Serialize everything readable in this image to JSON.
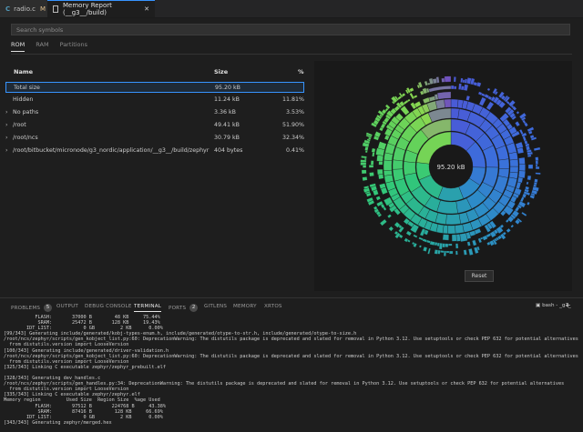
{
  "tabs": [
    {
      "icon": "C",
      "label": "radio.c",
      "status": "M"
    },
    {
      "label": "Memory Report (__g3__/build)",
      "close": "✕"
    }
  ],
  "search": {
    "placeholder": "Search symbols"
  },
  "subtabs": [
    "ROM",
    "RAM",
    "Partitions"
  ],
  "table": {
    "headers": {
      "name": "Name",
      "size": "Size",
      "percent": "%"
    },
    "rows": [
      {
        "name": "Total size",
        "size": "95.20 kB",
        "percent": "",
        "expandable": false,
        "selected": true
      },
      {
        "name": "Hidden",
        "size": "11.24 kB",
        "percent": "11.81%",
        "expandable": false
      },
      {
        "name": "No paths",
        "size": "3.36 kB",
        "percent": "3.53%",
        "expandable": true
      },
      {
        "name": "/root",
        "size": "49.41 kB",
        "percent": "51.90%",
        "expandable": true
      },
      {
        "name": "/root/ncs",
        "size": "30.79 kB",
        "percent": "32.34%",
        "expandable": true
      },
      {
        "name": "/root/bitbucket/micronode/g3_nordic/application/__g3__/build/zephyr",
        "size": "404 bytes",
        "percent": "0.41%",
        "expandable": true
      }
    ]
  },
  "chart": {
    "center_label": "95.20 kB",
    "reset_label": "Reset"
  },
  "panel": {
    "tabs": [
      {
        "label": "PROBLEMS",
        "badge": "5"
      },
      {
        "label": "OUTPUT"
      },
      {
        "label": "DEBUG CONSOLE"
      },
      {
        "label": "TERMINAL",
        "active": true
      },
      {
        "label": "PORTS",
        "badge": "2"
      },
      {
        "label": "GITLENS"
      },
      {
        "label": "MEMORY"
      },
      {
        "label": "XRTOS"
      }
    ],
    "terminal_label": "bash - _g1_",
    "plus": "+"
  },
  "terminal_lines": [
    "           FLASH:       37000 B        48 KB     75.44%",
    "            SRAM:       25472 B       128 KB     19.43%",
    "        IDT_LIST:           0 GB         2 KB      0.00%",
    "[99/343] Generating include/generated/kobj-types-enum.h, include/generated/otype-to-str.h, include/generated/otype-to-size.h",
    "/root/ncs/zephyr/scripts/gen_kobject_list.py:60: DeprecationWarning: The distutils package is deprecated and slated for removal in Python 3.12. Use setuptools or check PEP 632 for potential alternatives",
    "  from distutils.version import LooseVersion",
    "[100/343] Generating include/generated/driver-validation.h",
    "/root/ncs/zephyr/scripts/gen_kobject_list.py:60: DeprecationWarning: The distutils package is deprecated and slated for removal in Python 3.12. Use setuptools or check PEP 632 for potential alternatives",
    "  from distutils.version import LooseVersion",
    "[325/343] Linking C executable zephyr/zephyr_prebuilt.elf",
    "",
    "[328/343] Generating dev_handles.c",
    "/root/ncs/zephyr/scripts/gen_handles.py:34: DeprecationWarning: The distutils package is deprecated and slated for removal in Python 3.12. Use setuptools or check PEP 632 for potential alternatives",
    "  from distutils.version import LooseVersion",
    "[335/343] Linking C executable zephyr/zephyr.elf",
    "Memory region         Used Size  Region Size  %age Used",
    "           FLASH:       97512 B       224768 B     43.38%",
    "            SRAM:       87416 B        128 KB     66.69%",
    "        IDT_LIST:           0 GB         2 KB      0.00%",
    "[343/343] Generating zephyr/merged.hex"
  ]
}
